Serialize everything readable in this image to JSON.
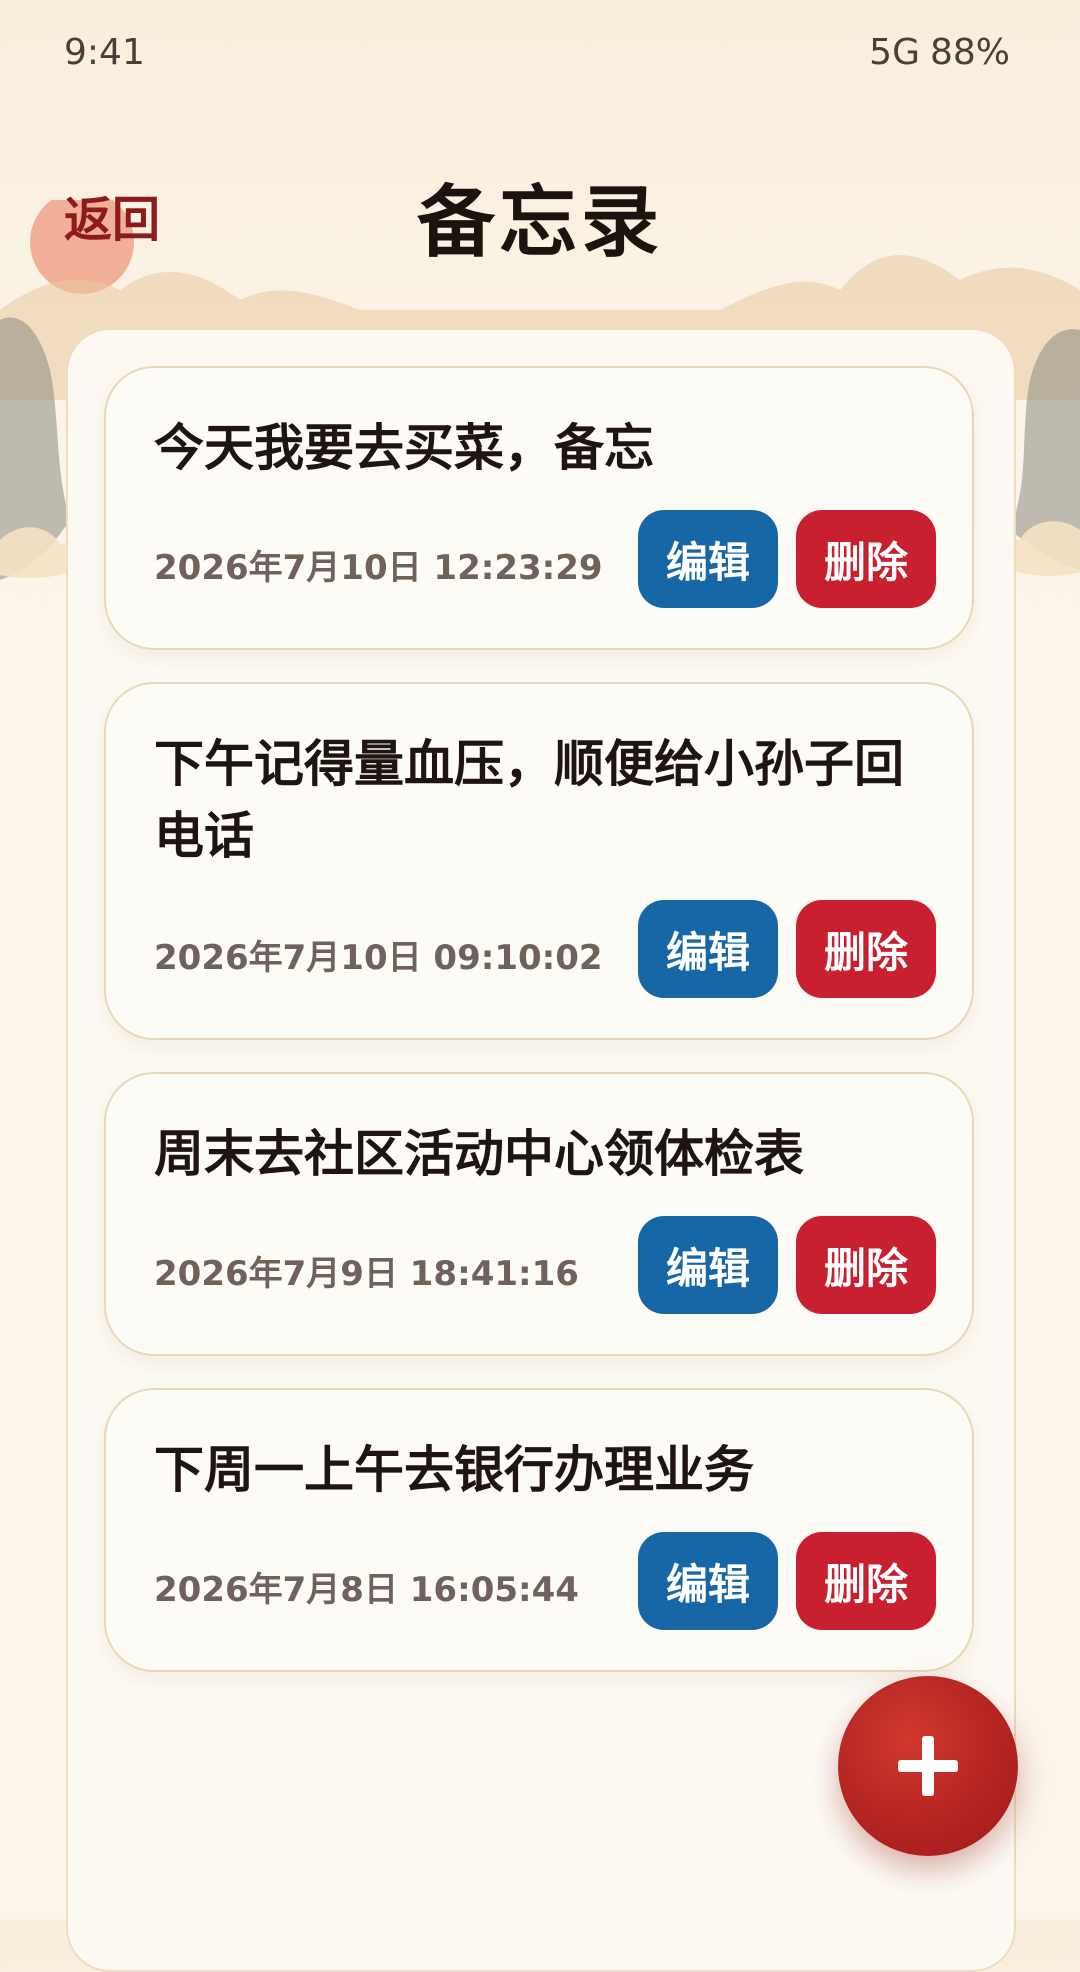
{
  "status_bar": {
    "time": "9:41",
    "network": "5G",
    "battery": "88%"
  },
  "header": {
    "back_label": "返回",
    "title": "备忘录"
  },
  "memos": [
    {
      "text": "今天我要去买菜，备忘",
      "time": "2026年7月10日 12:23:29",
      "edit_label": "编辑",
      "delete_label": "删除"
    },
    {
      "text": "下午记得量血压，顺便给小孙子回电话",
      "time": "2026年7月10日 09:10:02",
      "edit_label": "编辑",
      "delete_label": "删除"
    },
    {
      "text": "周末去社区活动中心领体检表",
      "time": "2026年7月9日 18:41:16",
      "edit_label": "编辑",
      "delete_label": "删除"
    },
    {
      "text": "下周一上午去银行办理业务",
      "time": "2026年7月8日 16:05:44",
      "edit_label": "编辑",
      "delete_label": "删除"
    }
  ],
  "fab": {
    "icon": "plus-icon"
  },
  "colors": {
    "accent_red": "#c8202f",
    "edit_blue": "#1767a6",
    "back_red": "#8e1b1b",
    "background": "#fcf6ec"
  }
}
